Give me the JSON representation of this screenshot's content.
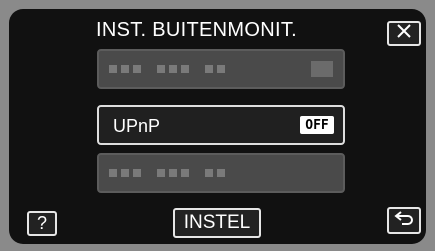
{
  "header": {
    "title": "INST. BUITENMONIT."
  },
  "menu": {
    "items": [
      {
        "label": "",
        "state": "disabled"
      },
      {
        "label": "UPnP",
        "value": "OFF",
        "state": "enabled"
      },
      {
        "label": "",
        "state": "disabled"
      }
    ]
  },
  "footer": {
    "help_label": "?",
    "set_label": "INSTEL"
  },
  "icons": {
    "close": "close-icon",
    "back": "back-arrow-icon"
  },
  "colors": {
    "background": "#111111",
    "disabled_item": "#4a4a4a",
    "text": "#ffffff"
  }
}
